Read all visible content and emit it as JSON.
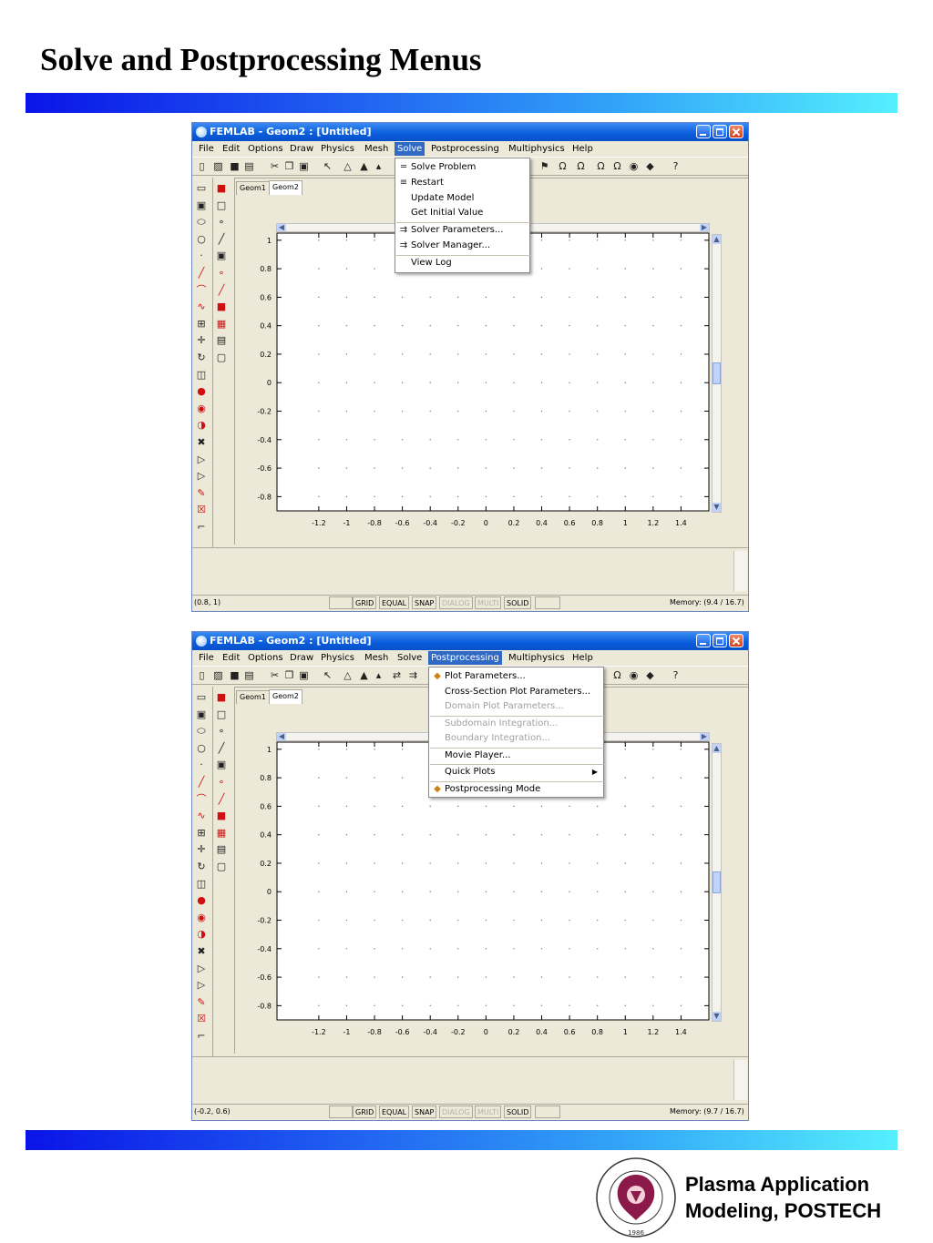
{
  "slide": {
    "title": "Solve and Postprocessing Menus",
    "footer_line1": "Plasma Application",
    "footer_line2": "Modeling, POSTECH",
    "logo_text": "POHANG UNIVERSITY OF SCIENCE AND TECHNOLOGY",
    "logo_year": "1986"
  },
  "window1": {
    "title": "FEMLAB - Geom2 : [Untitled]",
    "menus": [
      "File",
      "Edit",
      "Options",
      "Draw",
      "Physics",
      "Mesh",
      "Solve",
      "Postprocessing",
      "Multiphysics",
      "Help"
    ],
    "active_menu": "Solve",
    "tabs": [
      "Geom1",
      "Geom2"
    ],
    "dropdown": [
      {
        "label": "Solve Problem",
        "icon": "solve-problem-icon"
      },
      {
        "label": "Restart",
        "icon": "restart-icon"
      },
      {
        "label": "Update Model",
        "icon": ""
      },
      {
        "label": "Get Initial Value",
        "icon": ""
      },
      {
        "label": "Solver Parameters...",
        "icon": "solver-parameters-icon"
      },
      {
        "label": "Solver Manager...",
        "icon": "solver-manager-icon"
      },
      {
        "label": "View Log",
        "icon": ""
      }
    ],
    "status": {
      "coords": "(0.8, 1)",
      "grid": "GRID",
      "equal": "EQUAL",
      "snap": "SNAP",
      "dialog": "DIALOG",
      "multi": "MULTI",
      "solid": "SOLID",
      "memory": "Memory: (9.4 / 16.7)"
    }
  },
  "window2": {
    "title": "FEMLAB - Geom2 : [Untitled]",
    "menus": [
      "File",
      "Edit",
      "Options",
      "Draw",
      "Physics",
      "Mesh",
      "Solve",
      "Postprocessing",
      "Multiphysics",
      "Help"
    ],
    "active_menu": "Postprocessing",
    "tabs": [
      "Geom1",
      "Geom2"
    ],
    "dropdown": [
      {
        "label": "Plot Parameters...",
        "icon": "plot-parameters-icon",
        "disabled": false
      },
      {
        "label": "Cross-Section Plot Parameters...",
        "icon": "",
        "disabled": false
      },
      {
        "label": "Domain Plot Parameters...",
        "icon": "",
        "disabled": true
      },
      {
        "label": "Subdomain Integration...",
        "icon": "",
        "disabled": true
      },
      {
        "label": "Boundary Integration...",
        "icon": "",
        "disabled": true
      },
      {
        "label": "Movie Player...",
        "icon": "",
        "disabled": false
      },
      {
        "label": "Quick Plots",
        "icon": "",
        "disabled": false,
        "submenu": true
      },
      {
        "label": "Postprocessing Mode",
        "icon": "postprocessing-mode-icon",
        "disabled": false
      }
    ],
    "status": {
      "coords": "(-0.2, 0.6)",
      "grid": "GRID",
      "equal": "EQUAL",
      "snap": "SNAP",
      "dialog": "DIALOG",
      "multi": "MULTI",
      "solid": "SOLID",
      "memory": "Memory: (9.7 / 16.7)"
    }
  },
  "axes": {
    "x_ticks": [
      "-1.2",
      "-1",
      "-0.8",
      "-0.6",
      "-0.4",
      "-0.2",
      "0",
      "0.2",
      "0.4",
      "0.6",
      "0.8",
      "1",
      "1.2",
      "1.4"
    ],
    "y_ticks": [
      "1",
      "0.8",
      "0.6",
      "0.4",
      "0.2",
      "0",
      "-0.2",
      "-0.4",
      "-0.6",
      "-0.8"
    ]
  }
}
